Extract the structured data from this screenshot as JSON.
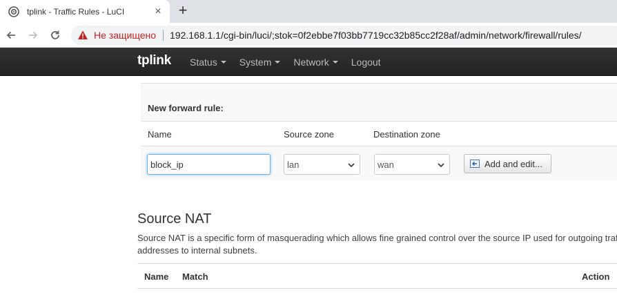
{
  "browser": {
    "tab_title": "tplink - Traffic Rules - LuCI",
    "close_glyph": "×",
    "new_tab_glyph": "+",
    "not_secure": "Не защищено",
    "url": "192.168.1.1/cgi-bin/luci/;stok=0f2ebbe7f03bb7719cc32b85cc2f28af/admin/network/firewall/rules/"
  },
  "header": {
    "brand": "tplink",
    "menu": [
      {
        "label": "Status",
        "dropdown": true
      },
      {
        "label": "System",
        "dropdown": true
      },
      {
        "label": "Network",
        "dropdown": true
      },
      {
        "label": "Logout",
        "dropdown": false
      }
    ]
  },
  "forward_rule": {
    "title": "New forward rule:",
    "columns": {
      "name": "Name",
      "source_zone": "Source zone",
      "destination_zone": "Destination zone"
    },
    "name_value": "block_ip",
    "source_zone_value": "lan",
    "destination_zone_value": "wan",
    "add_button": "Add and edit..."
  },
  "source_nat": {
    "title": "Source NAT",
    "description_line1": "Source NAT is a specific form of masquerading which allows fine grained control over the source IP used for outgoing traffic, for example to map multiple WAN",
    "description_line2": "addresses to internal subnets.",
    "columns": {
      "name": "Name",
      "match": "Match",
      "action": "Action"
    }
  },
  "colors": {
    "header_bg": "#222222",
    "focus_border": "#66afe9",
    "not_secure": "#c5221f"
  }
}
